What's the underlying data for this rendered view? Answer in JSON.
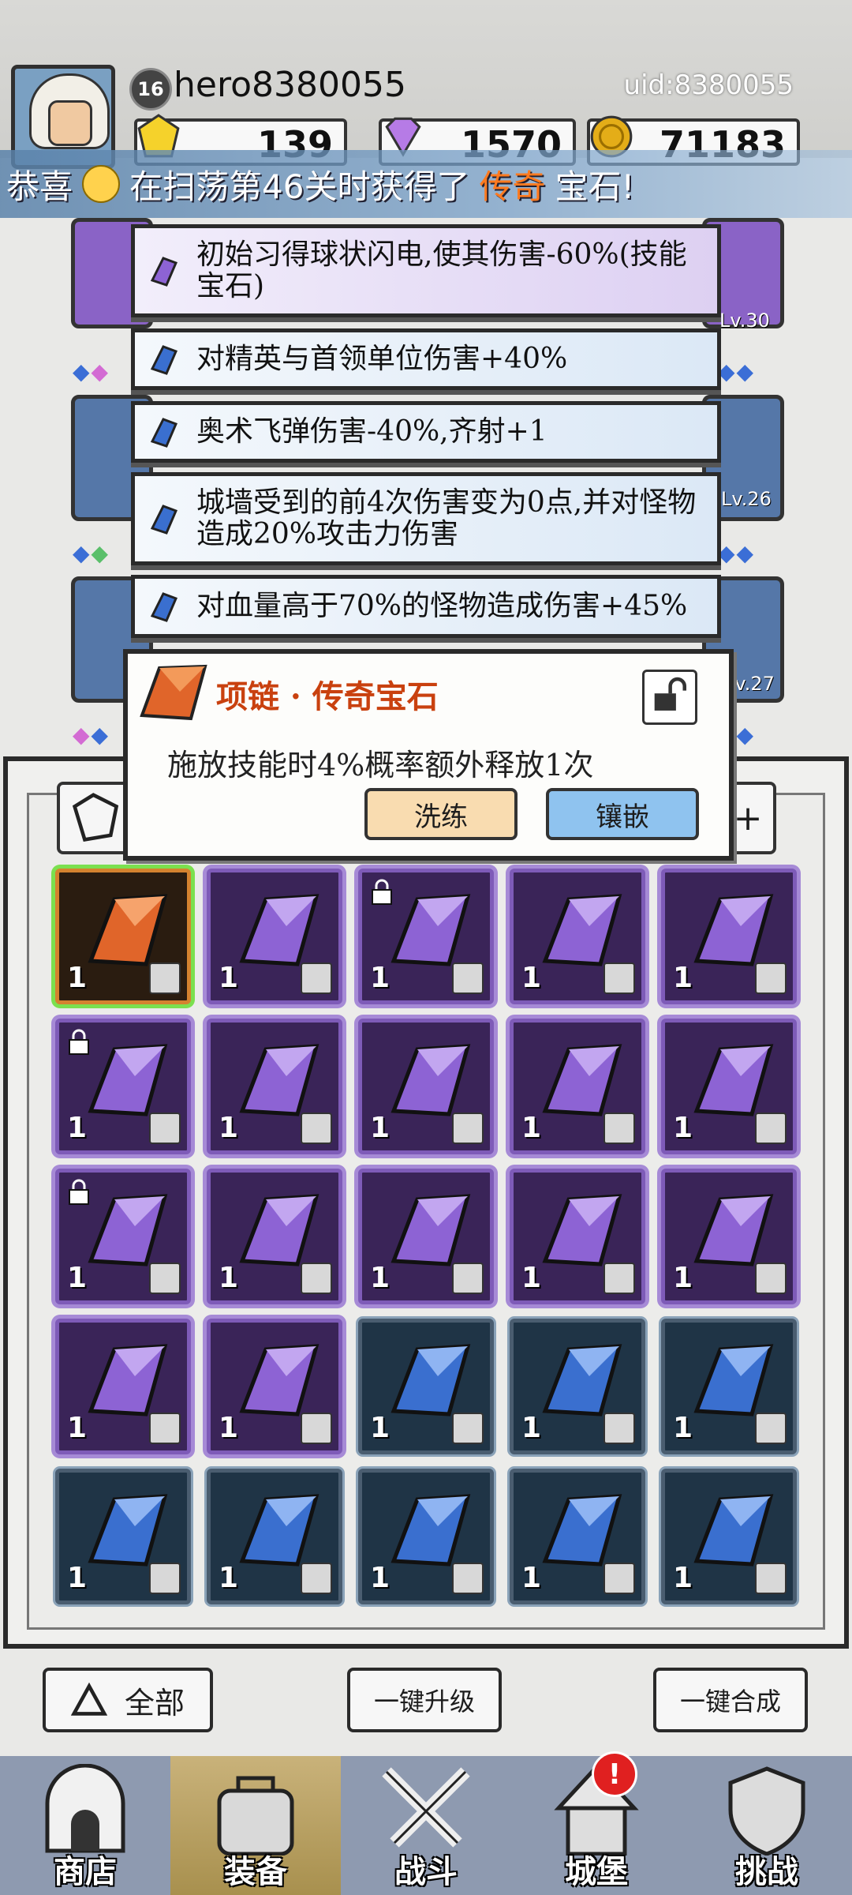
{
  "header": {
    "level": "16",
    "username": "hero8380055",
    "uid": "uid:8380055",
    "currencies": [
      {
        "name": "yellow-gem",
        "value": "139",
        "color": "#f5d22b"
      },
      {
        "name": "purple-diamond",
        "value": "1570",
        "color": "#b67be6"
      },
      {
        "name": "gold-coin",
        "value": "71183",
        "color": "#e4ad18"
      }
    ]
  },
  "announcement": {
    "prefix": "恭喜",
    "middle": "在扫荡第46关时获得了",
    "highlight": "传奇",
    "suffix": "宝石!"
  },
  "slots": {
    "levels": [
      "Lv.30",
      "Lv.26",
      "Lv.27"
    ]
  },
  "skills": [
    {
      "text": "初始习得球状闪电,使其伤害-60%(技能宝石)",
      "gem": "purple"
    },
    {
      "text": "对精英与首领单位伤害+40%",
      "gem": "blue"
    },
    {
      "text": "奥术飞弹伤害-40%,齐射+1",
      "gem": "blue"
    },
    {
      "text": "城墙受到的前4次伤害变为0点,并对怪物造成20%攻击力伤害",
      "gem": "blue"
    },
    {
      "text": "对血量高于70%的怪物造成伤害+45%",
      "gem": "blue"
    }
  ],
  "popup": {
    "title": "项链 · 传奇宝石",
    "description": "施放技能时4%概率额外释放1次",
    "refine_label": "洗练",
    "inlay_label": "镶嵌"
  },
  "inventory": {
    "add_label": "+",
    "items": [
      {
        "rarity": "orange",
        "qty": "1",
        "type": "necklace",
        "locked": false
      },
      {
        "rarity": "purple",
        "qty": "1",
        "type": "ring",
        "locked": false
      },
      {
        "rarity": "purple",
        "qty": "1",
        "type": "ring",
        "locked": true
      },
      {
        "rarity": "purple",
        "qty": "1",
        "type": "armor",
        "locked": false
      },
      {
        "rarity": "purple",
        "qty": "1",
        "type": "armor",
        "locked": false
      },
      {
        "rarity": "purple",
        "qty": "1",
        "type": "armor",
        "locked": true
      },
      {
        "rarity": "purple",
        "qty": "1",
        "type": "boots",
        "locked": false
      },
      {
        "rarity": "purple",
        "qty": "1",
        "type": "boots",
        "locked": false
      },
      {
        "rarity": "purple",
        "qty": "1",
        "type": "boots",
        "locked": false
      },
      {
        "rarity": "purple",
        "qty": "1",
        "type": "boots",
        "locked": false
      },
      {
        "rarity": "purple",
        "qty": "1",
        "type": "wand",
        "locked": true
      },
      {
        "rarity": "purple",
        "qty": "1",
        "type": "wand",
        "locked": false
      },
      {
        "rarity": "purple",
        "qty": "1",
        "type": "wand",
        "locked": false
      },
      {
        "rarity": "purple",
        "qty": "1",
        "type": "helmet",
        "locked": false
      },
      {
        "rarity": "purple",
        "qty": "1",
        "type": "helmet",
        "locked": false
      },
      {
        "rarity": "purple",
        "qty": "1",
        "type": "helmet",
        "locked": false
      },
      {
        "rarity": "purple",
        "qty": "1",
        "type": "helmet",
        "locked": false
      },
      {
        "rarity": "blue",
        "qty": "1",
        "type": "ring",
        "locked": false
      },
      {
        "rarity": "blue",
        "qty": "1",
        "type": "armor",
        "locked": false
      },
      {
        "rarity": "blue",
        "qty": "1",
        "type": "armor",
        "locked": false
      },
      {
        "rarity": "blue",
        "qty": "1",
        "type": "boots",
        "locked": false
      },
      {
        "rarity": "blue",
        "qty": "1",
        "type": "boots",
        "locked": false
      },
      {
        "rarity": "blue",
        "qty": "1",
        "type": "helmet",
        "locked": false
      },
      {
        "rarity": "blue",
        "qty": "1",
        "type": "helmet",
        "locked": false
      },
      {
        "rarity": "blue",
        "qty": "1",
        "type": "helmet",
        "locked": false
      }
    ]
  },
  "actions": {
    "all_label": "全部",
    "upgrade_label": "一键升级",
    "merge_label": "一键合成"
  },
  "nav": [
    {
      "label": "商店",
      "icon": "shop-icon",
      "active": false
    },
    {
      "label": "装备",
      "icon": "bag-icon",
      "active": true
    },
    {
      "label": "战斗",
      "icon": "swords-icon",
      "active": false
    },
    {
      "label": "城堡",
      "icon": "castle-icon",
      "active": false,
      "alert": "!"
    },
    {
      "label": "挑战",
      "icon": "shield-icon",
      "active": false
    }
  ],
  "colors": {
    "purple_gem": "#8d63d4",
    "blue_gem": "#3a6fcf",
    "orange_gem": "#e0652a",
    "legend_orange": "#c9410f"
  }
}
